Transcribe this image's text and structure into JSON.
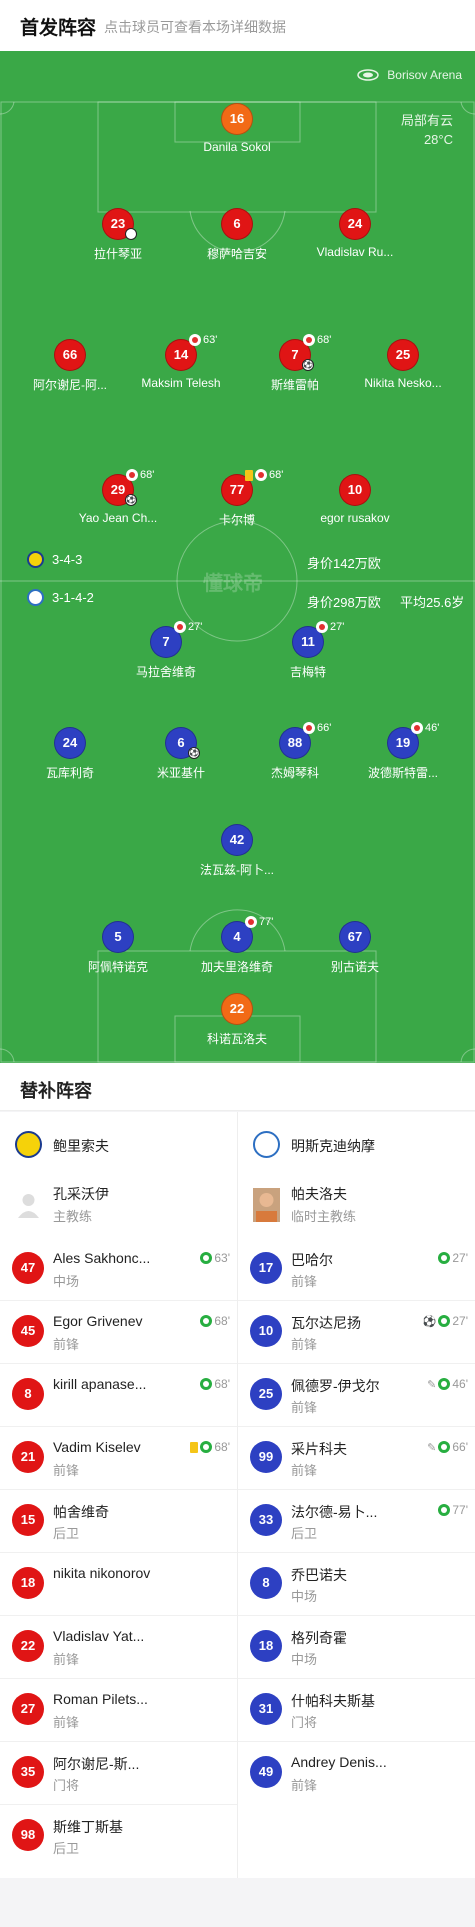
{
  "header": {
    "title": "首发阵容",
    "hint": "点击球员可查看本场详细数据"
  },
  "pitch": {
    "stadium": "Borisov Arena",
    "weather": "局部有云",
    "temperature": "28°C",
    "watermark": "懂球帝",
    "home_formation": "3-4-3",
    "home_value": "身价142万欧",
    "away_formation": "3-1-4-2",
    "away_value": "身价298万欧",
    "away_age": "平均25.6岁"
  },
  "home_players": [
    {
      "num": "16",
      "name": "Danila Sokol",
      "gk": true
    },
    {
      "num": "23",
      "name": "拉什琴亚"
    },
    {
      "num": "6",
      "name": "穆萨哈吉安"
    },
    {
      "num": "24",
      "name": "Vladislav Ru..."
    },
    {
      "num": "66",
      "name": "阿尔谢尼-阿..."
    },
    {
      "num": "14",
      "name": "Maksim Telesh",
      "sub": "63'"
    },
    {
      "num": "7",
      "name": "斯维雷帕",
      "sub": "68'"
    },
    {
      "num": "25",
      "name": "Nikita Nesko..."
    },
    {
      "num": "29",
      "name": "Yao Jean Ch...",
      "sub": "68'"
    },
    {
      "num": "77",
      "name": "卡尔博",
      "sub": "68'"
    },
    {
      "num": "10",
      "name": "egor rusakov"
    }
  ],
  "away_players": [
    {
      "num": "7",
      "name": "马拉舍维奇",
      "sub": "27'"
    },
    {
      "num": "11",
      "name": "吉梅特",
      "sub": "27'"
    },
    {
      "num": "24",
      "name": "瓦库利奇"
    },
    {
      "num": "6",
      "name": "米亚基什"
    },
    {
      "num": "88",
      "name": "杰姆琴科",
      "sub": "66'"
    },
    {
      "num": "19",
      "name": "波德斯特雷...",
      "sub": "46'"
    },
    {
      "num": "42",
      "name": "法瓦兹-阿卜..."
    },
    {
      "num": "5",
      "name": "阿佩特诺克"
    },
    {
      "num": "4",
      "name": "加夫里洛维奇",
      "sub": "77'"
    },
    {
      "num": "67",
      "name": "别古诺夫"
    },
    {
      "num": "22",
      "name": "科诺瓦洛夫",
      "gk": true
    }
  ],
  "subs": {
    "title": "替补阵容",
    "home": {
      "team": "鲍里索夫",
      "coach": "孔采沃伊",
      "coach_role": "主教练",
      "players": [
        {
          "num": "47",
          "name": "Ales Sakhonc...",
          "pos": "中场",
          "in": "63'"
        },
        {
          "num": "45",
          "name": "Egor Grivenev",
          "pos": "前锋",
          "in": "68'"
        },
        {
          "num": "8",
          "name": "kirill apanase...",
          "pos": "",
          "in": "68'"
        },
        {
          "num": "21",
          "name": "Vadim Kiselev",
          "pos": "前锋",
          "in": "68'"
        },
        {
          "num": "15",
          "name": "帕舍维奇",
          "pos": "后卫",
          "in": ""
        },
        {
          "num": "18",
          "name": "nikita nikonorov",
          "pos": "",
          "in": ""
        },
        {
          "num": "22",
          "name": "Vladislav Yat...",
          "pos": "前锋",
          "in": ""
        },
        {
          "num": "27",
          "name": "Roman Pilets...",
          "pos": "前锋",
          "in": ""
        },
        {
          "num": "35",
          "name": "阿尔谢尼-斯...",
          "pos": "门将",
          "in": ""
        },
        {
          "num": "98",
          "name": "斯维丁斯基",
          "pos": "后卫",
          "in": ""
        }
      ]
    },
    "away": {
      "team": "明斯克迪纳摩",
      "coach": "帕夫洛夫",
      "coach_role": "临时主教练",
      "players": [
        {
          "num": "17",
          "name": "巴哈尔",
          "pos": "前锋",
          "in": "27'"
        },
        {
          "num": "10",
          "name": "瓦尔达尼扬",
          "pos": "前锋",
          "in": "27'"
        },
        {
          "num": "25",
          "name": "佩德罗-伊戈尔",
          "pos": "前锋",
          "in": "46'"
        },
        {
          "num": "99",
          "name": "采片科夫",
          "pos": "前锋",
          "in": "66'"
        },
        {
          "num": "33",
          "name": "法尔德-易卜...",
          "pos": "后卫",
          "in": "77'"
        },
        {
          "num": "8",
          "name": "乔巴诺夫",
          "pos": "中场",
          "in": ""
        },
        {
          "num": "18",
          "name": "格列奇霍",
          "pos": "中场",
          "in": ""
        },
        {
          "num": "31",
          "name": "什帕科夫斯基",
          "pos": "门将",
          "in": ""
        },
        {
          "num": "49",
          "name": "Andrey Denis...",
          "pos": "前锋",
          "in": ""
        }
      ]
    }
  },
  "colors": {
    "pitch": "#3aa847",
    "home": "#e01515",
    "away": "#2d40c2",
    "goalkeeper": "#f26a16",
    "sub_in": "#27ae40"
  },
  "icons": [
    "stadium-icon",
    "goal-ball-icon",
    "sub-out-icon",
    "sub-in-icon",
    "yellow-card-icon",
    "assist-icon"
  ]
}
